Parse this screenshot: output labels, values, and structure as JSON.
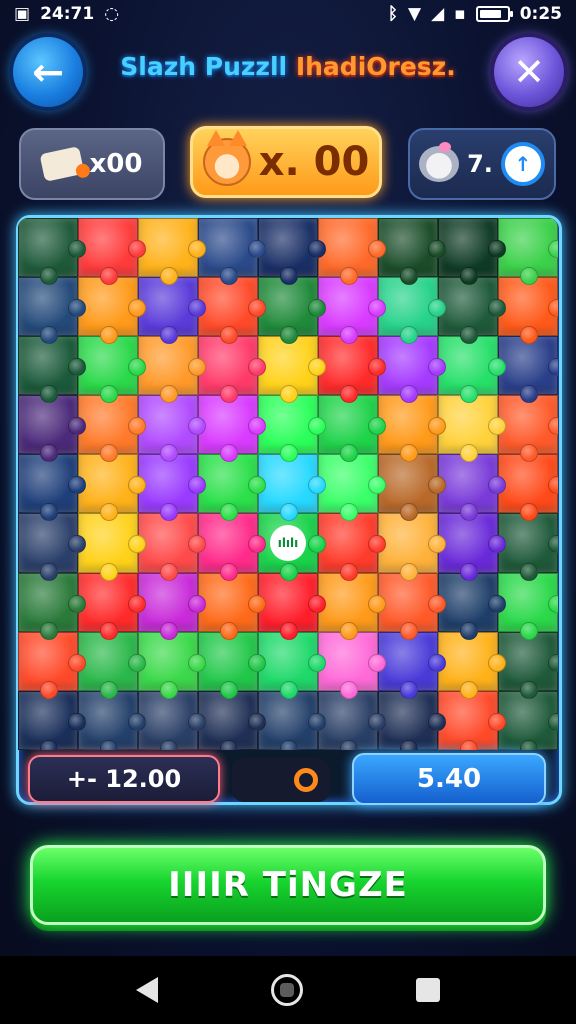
{
  "status_bar": {
    "left_text": "24:71",
    "right_time": "0:25",
    "battery_level": 0.8,
    "icons": [
      "sync-icon",
      "bluetooth-icon",
      "wifi-icon",
      "signal-icon",
      "sim-icon",
      "battery-icon"
    ]
  },
  "header": {
    "title_part1": "Slazh Puzzll",
    "title_part2": "IhadiOresz.",
    "back_icon": "arrow-left-icon",
    "close_icon": "close-icon"
  },
  "stats": {
    "left": {
      "icon": "ticket-icon",
      "value": "x00"
    },
    "middle": {
      "icon": "fox-icon",
      "value": "x. 00"
    },
    "right": {
      "icon": "mouse-icon",
      "value": "7.",
      "timer_icon": "clock-icon"
    }
  },
  "board": {
    "rows": 9,
    "cols": 9,
    "center_icon": "hint-icon",
    "center_label": "ılılı",
    "piece_colors": [
      "#1f5a3a",
      "#ff3b3b",
      "#ffb21a",
      "#2b4a8a",
      "#1a2f66",
      "#ff6a2a",
      "#1b4d2a",
      "#0f3b24",
      "#3bd14a",
      "#244a7a",
      "#ff9a1a",
      "#5a3bd9",
      "#ff4a2a",
      "#1f8a3a",
      "#d93bff",
      "#27d38a",
      "#1f5a3a",
      "#ff5a1a",
      "#1b5a3a",
      "#2bd94a",
      "#ff9a2a",
      "#ff3b6a",
      "#ffd21a",
      "#ff2b2b",
      "#a53bff",
      "#27e06a",
      "#2a3f8a",
      "#4b2a7a",
      "#ff7a2a",
      "#b14bff",
      "#d93bff",
      "#2bff5a",
      "#1fd34a",
      "#ff9a1a",
      "#ffd23b",
      "#ff5a2a",
      "#1f3f7a",
      "#ffb21a",
      "#9a3bff",
      "#2be04a",
      "#27d9ff",
      "#3bff6a",
      "#b96a2a",
      "#7a3bd9",
      "#ff4a1a",
      "#2a3f6a",
      "#ffd21a",
      "#ff4a4a",
      "#ff2b8a",
      "#1ad34a",
      "#ff3b2b",
      "#ffb23b",
      "#6a2ad9",
      "#1f5a3a",
      "#2a7a3a",
      "#ff2b2b",
      "#c92bd9",
      "#ff6a1a",
      "#ff1f2b",
      "#ff9a1a",
      "#ff5a2a",
      "#1f3f6a",
      "#2bd94a",
      "#ff4a2a",
      "#2bb84a",
      "#3bd94a",
      "#22c84a",
      "#1fd96a",
      "#ff6ad9",
      "#4a3bd9",
      "#ffb21a",
      "#1f5a3a",
      "#1a2f5a",
      "#23406a",
      "#2a3f66",
      "#1f2f55",
      "#23406a",
      "#2a3f66",
      "#1f2f55",
      "#ff4a2a",
      "#1f5a3a"
    ]
  },
  "bottom_bars": {
    "left_value": "+- 12.00",
    "middle_icon": "ring-icon",
    "right_value": "5.40"
  },
  "main_button": {
    "label": "IIIIR TiNGZE"
  },
  "nav": {
    "back_icon": "nav-back-icon",
    "home_icon": "nav-home-icon",
    "recent_icon": "nav-recent-icon"
  }
}
